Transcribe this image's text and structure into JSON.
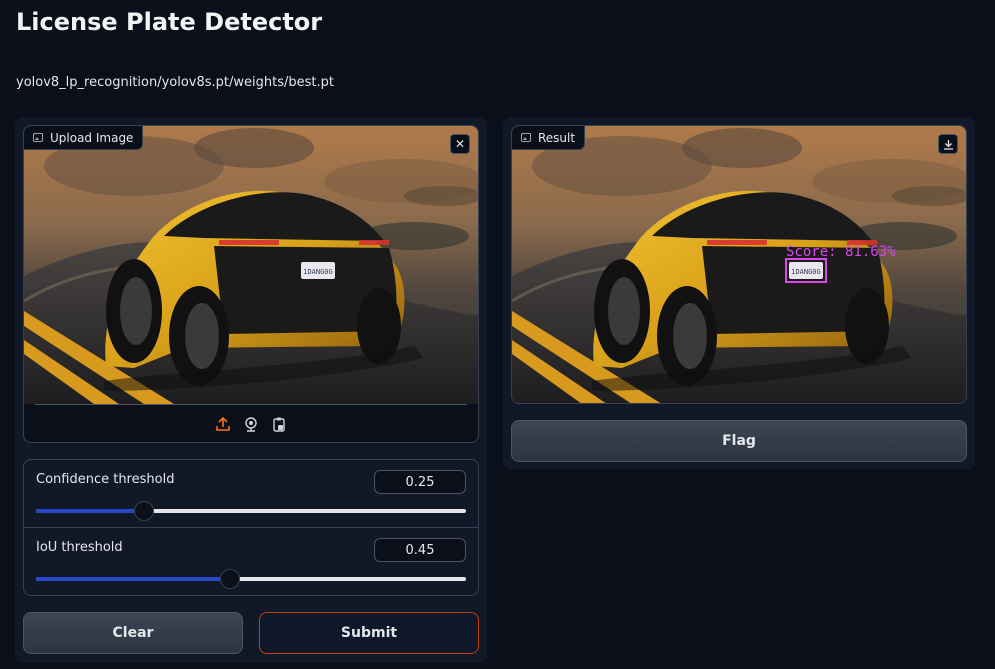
{
  "app": {
    "title": "License Plate Detector",
    "model_path": "yolov8_lp_recognition/yolov8s.pt/weights/best.pt"
  },
  "input_image": {
    "label": "Upload Image",
    "label_icon": "image-icon",
    "clear_icon": "close-icon",
    "plate_text": "1DANG0G",
    "tools": [
      "upload-icon",
      "webcam-icon",
      "clipboard-icon"
    ],
    "accent_color": "#f97316"
  },
  "result_image": {
    "label": "Result",
    "label_icon": "image-icon",
    "download_icon": "download-icon",
    "plate_text": "1DANG0G",
    "detection_text": "Score: 81.63%",
    "box_color": "#d946ef"
  },
  "sliders": [
    {
      "label": "Confidence threshold",
      "value": "0.25",
      "fraction": 0.25
    },
    {
      "label": "IoU threshold",
      "value": "0.45",
      "fraction": 0.45
    }
  ],
  "buttons": {
    "clear": "Clear",
    "submit": "Submit",
    "flag": "Flag"
  },
  "colors": {
    "background": "#0b0f19",
    "panel": "#111827",
    "slider_fill": "#2548c9",
    "submit_border": "#c2410c"
  }
}
